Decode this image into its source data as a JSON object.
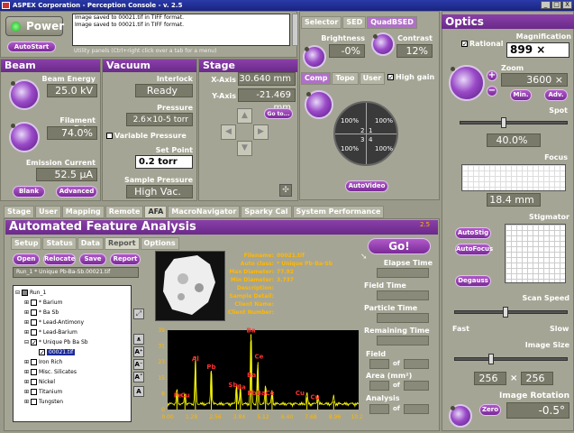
{
  "window": {
    "title": "ASPEX Corporation - Perception Console - v. 2.5",
    "controls": [
      "_",
      "□",
      "X"
    ]
  },
  "top": {
    "power_label": "Power",
    "autostart_label": "AutoStart",
    "messages": [
      "Image saved to 00021.tif in TIFF format.",
      "Image saved to 00021.tif in TIFF format."
    ],
    "utility_hint": "Utility panels (Ctrl+right click over a tab for a menu)"
  },
  "beam": {
    "title": "Beam",
    "energy_label": "Beam Energy",
    "energy_value": "25.0 kV",
    "filament_label": "Filament Drive",
    "filament_value": "74.0%",
    "emission_label": "Emission Current",
    "emission_value": "52.5 µA",
    "blank_label": "Blank",
    "advanced_label": "Advanced"
  },
  "vacuum": {
    "title": "Vacuum",
    "interlock_label": "Interlock",
    "interlock_value": "Ready",
    "pressure_label": "Pressure",
    "pressure_value": "2.6×10-5 torr",
    "variable_label": "Variable Pressure",
    "setpoint_label": "Set Point",
    "setpoint_value": "0.2 torr",
    "sample_pressure_label": "Sample Pressure",
    "sample_pressure_value": "High Vac."
  },
  "stage": {
    "title": "Stage",
    "x_label": "X-Axis",
    "x_value": "30.640 mm",
    "y_label": "Y-Axis",
    "y_value": "-21.469 mm",
    "goto_label": "Go to..."
  },
  "detector": {
    "tabs": [
      "Selector",
      "SED",
      "QuadBSED"
    ],
    "brightness_label": "Brightness",
    "brightness_value": "-0%",
    "contrast_label": "Contrast",
    "contrast_value": "12%",
    "mode_tabs": [
      "Comp",
      "Topo",
      "User"
    ],
    "highgain_label": "High gain",
    "quadrants": [
      {
        "pct": "100%",
        "n": "2"
      },
      {
        "pct": "100%",
        "n": "1"
      },
      {
        "pct": "100%",
        "n": "3"
      },
      {
        "pct": "100%",
        "n": "4"
      }
    ],
    "autovideo_label": "AutoVideo"
  },
  "lower_tabs": [
    "Stage",
    "User",
    "Mapping",
    "Remote",
    "AFA",
    "MacroNavigator",
    "Sparky Cal",
    "System Performance"
  ],
  "afa": {
    "title": "Automated Feature Analysis",
    "version": "2.5",
    "tabs": [
      "Setup",
      "Status",
      "Data",
      "Report",
      "Options"
    ],
    "buttons": [
      "Open",
      "Relocate",
      "Save",
      "Report"
    ],
    "run_name": "Run_1 * Unique Pb-Ba-Sb.00021.tif",
    "go_label": "Go!",
    "info": [
      {
        "k": "Filename:",
        "v": "00021.tif"
      },
      {
        "k": "Auto class:",
        "v": "* Unique Pb-Ba-Sb"
      },
      {
        "k": "Max Diameter:",
        "v": "77.92"
      },
      {
        "k": "Min Diameter:",
        "v": "3.737"
      },
      {
        "k": "Description:",
        "v": ""
      },
      {
        "k": "Sample Detail:",
        "v": ""
      },
      {
        "k": "Client Name:",
        "v": ""
      },
      {
        "k": "Client Number:",
        "v": ""
      }
    ],
    "fields": [
      "Elapse Time",
      "Field Time",
      "Particle Time",
      "Remaining Time"
    ],
    "field_label": "Field",
    "area_label": "Area (mm²)",
    "analysis_label": "Analysis",
    "of_label": "of",
    "tree": [
      "Run_1",
      "* Barium",
      "* Ba Sb",
      "* Lead-Antimony",
      "* Lead-Barium",
      "* Unique Pb Ba Sb",
      "00021.tif",
      "Iron Rich",
      "Misc. Silicates",
      "Nickel",
      "Titanium",
      "Tungsten"
    ]
  },
  "chart_data": {
    "type": "line",
    "title": "",
    "xlabel": "",
    "ylabel": "",
    "x_ticks": [
      "0.00",
      "1.28",
      "2.56",
      "3.84",
      "5.12",
      "6.40",
      "7.68",
      "8.96",
      "10.24"
    ],
    "y_ticks": [
      "0",
      "8",
      "15",
      "23",
      "31",
      "39"
    ],
    "xlim": [
      0,
      10.24
    ],
    "ylim": [
      0,
      39
    ],
    "peaks": [
      {
        "x": 0.5,
        "y": 8
      },
      {
        "x": 0.93,
        "y": 6
      },
      {
        "x": 1.49,
        "y": 23
      },
      {
        "x": 2.34,
        "y": 19
      },
      {
        "x": 3.69,
        "y": 10
      },
      {
        "x": 3.9,
        "y": 9
      },
      {
        "x": 4.47,
        "y": 37
      },
      {
        "x": 4.83,
        "y": 22
      },
      {
        "x": 5.25,
        "y": 10
      },
      {
        "x": 5.6,
        "y": 7
      },
      {
        "x": 7.47,
        "y": 6
      },
      {
        "x": 8.05,
        "y": 5
      },
      {
        "x": 8.9,
        "y": 4
      }
    ],
    "labels": [
      {
        "x": 0.55,
        "y": 6,
        "t": "Fe"
      },
      {
        "x": 0.95,
        "y": 6,
        "t": "Cu"
      },
      {
        "x": 1.49,
        "y": 24,
        "t": "Al"
      },
      {
        "x": 2.34,
        "y": 20,
        "t": "Pb"
      },
      {
        "x": 3.5,
        "y": 11,
        "t": "Sb"
      },
      {
        "x": 3.95,
        "y": 10,
        "t": "Ba"
      },
      {
        "x": 4.47,
        "y": 38,
        "t": "Ba"
      },
      {
        "x": 4.9,
        "y": 25,
        "t": "Ce"
      },
      {
        "x": 4.5,
        "y": 16,
        "t": "Ba"
      },
      {
        "x": 5.0,
        "y": 7,
        "t": "PbBaCe"
      },
      {
        "x": 7.1,
        "y": 7,
        "t": "Cu"
      },
      {
        "x": 7.9,
        "y": 5,
        "t": "Cu"
      }
    ]
  },
  "optics": {
    "title": "Optics",
    "rational_label": "Rational",
    "magnification_label": "Magnification",
    "magnification_value": "899 ×",
    "zoom_label": "Zoom",
    "zoom_value": "3600 ×",
    "min_label": "Min.",
    "adv_label": "Adv.",
    "spot_label": "Spot",
    "spot_value": "40.0%",
    "focus_label": "Focus",
    "focus_value": "18.4 mm",
    "stigmator_label": "Stigmator",
    "autostig_label": "AutoStig",
    "autofocus_label": "AutoFocus",
    "degauss_label": "Degauss",
    "scanspeed_label": "Scan Speed",
    "fast_label": "Fast",
    "slow_label": "Slow",
    "imagesize_label": "Image Size",
    "size_w": "256",
    "size_x": "×",
    "size_h": "256",
    "rotation_label": "Image Rotation",
    "zero_label": "Zero",
    "rotation_value": "-0.5°",
    "plus": "+",
    "minus": "−"
  },
  "colors": {
    "accent": "#8a3fa8",
    "panel": "#a5a595",
    "spectrum": "#ffff00",
    "label": "#ffb800"
  }
}
